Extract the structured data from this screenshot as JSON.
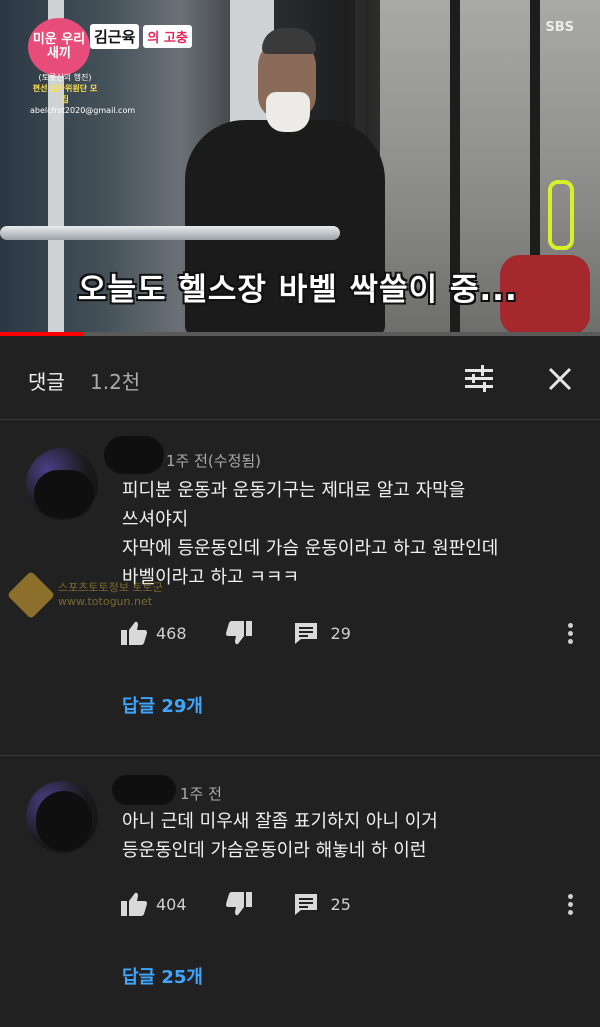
{
  "video": {
    "show_logo": "미운 우리새끼",
    "show_name": "김근육",
    "show_tag": "의 고충",
    "recruit_line1": "(토롯신의 행진)",
    "recruit_line2": "편선 심사위원단 모집",
    "recruit_line3": "abelcfrst2020@gmail.com",
    "channel": "SBS",
    "subtitle": "오늘도 헬스장 바벨 싹쓸이 중...",
    "progress_percent": 14
  },
  "comments_header": {
    "title": "댓글",
    "count": "1.2천",
    "filter_icon": "sort-filter-icon",
    "close_icon": "close-icon"
  },
  "comments": [
    {
      "time": "1주 전(수정됨)",
      "lines": [
        "피디분 운동과 운동기구는 제대로 알고 자막을",
        "쓰셔야지",
        "자막에 등운동인데 가슴 운동이라고 하고 원판인데",
        "바벨이라고 하고 ㅋㅋㅋ"
      ],
      "likes": "468",
      "replies_count": "29",
      "replies_label": "답글 29개"
    },
    {
      "time": "1주 전",
      "lines": [
        "아니 근데 미우새  잘좀 표기하지 아니 이거",
        "등운동인데 가슴운동이라 해놓네 하 이런"
      ],
      "likes": "404",
      "replies_count": "25",
      "replies_label": "답글 25개"
    }
  ],
  "watermark": {
    "line1": "스포츠토토정보 토토군",
    "line2": "www.totogun.net"
  },
  "colors": {
    "background": "#212121",
    "link": "#3ea6ff",
    "progress": "#ff0000"
  }
}
